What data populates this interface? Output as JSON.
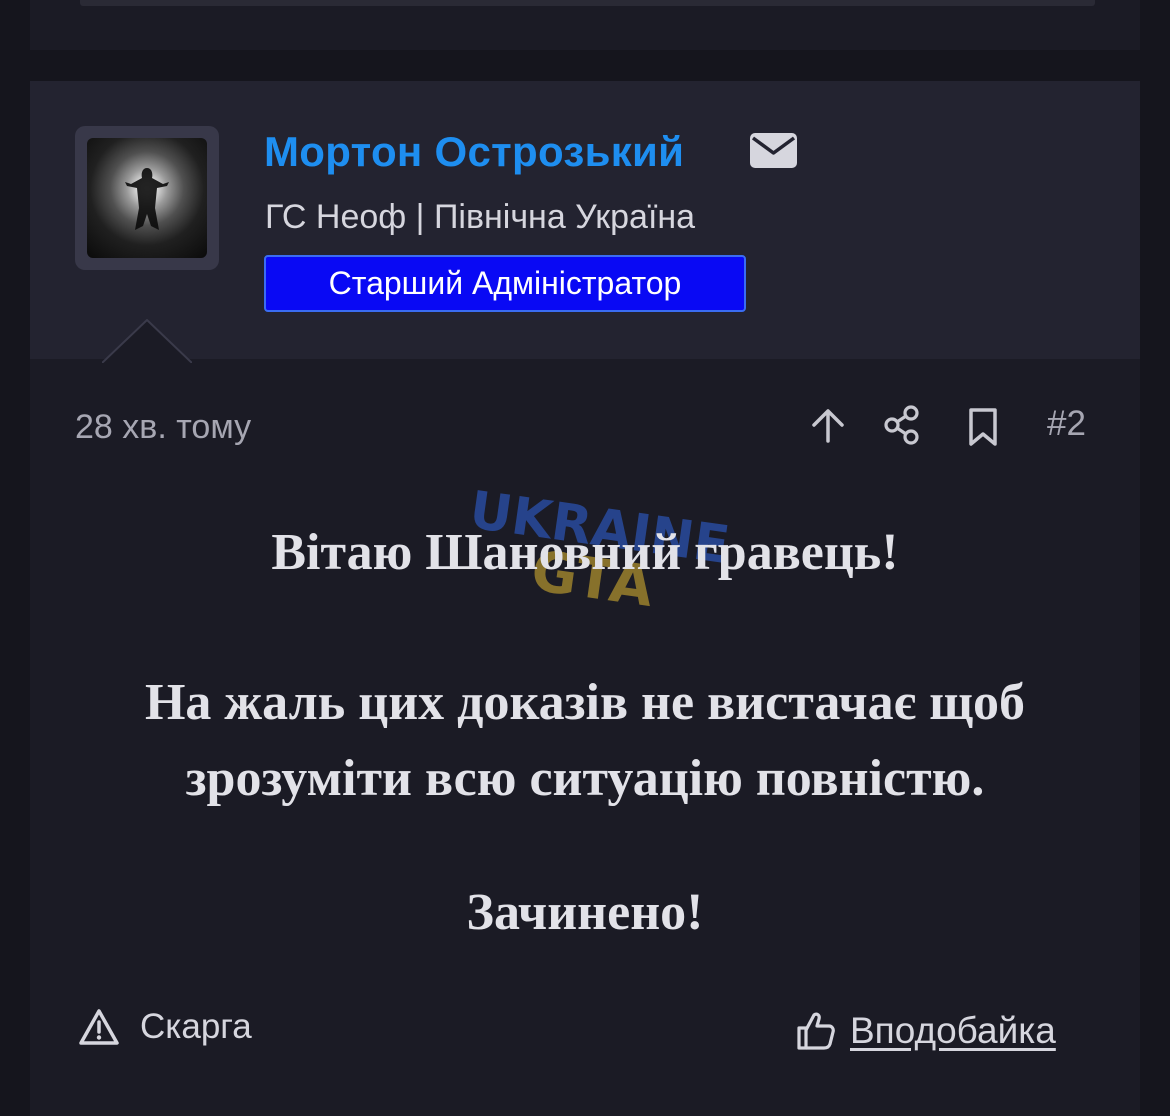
{
  "user": {
    "name": "Мортон Острозький",
    "title": "ГС Неоф | Північна Україна",
    "role": "Старший Адміністратор"
  },
  "post": {
    "time": "28 хв. тому",
    "number": "#2",
    "greeting": "Вітаю Шановний гравець!",
    "message_line1": "На жаль цих доказів не вистачає щоб",
    "message_line2": "зрозуміти всю ситуацію повністю.",
    "closing": "Зачинено!"
  },
  "actions": {
    "report_label": "Скарга",
    "like_label": "Вподобайка"
  },
  "watermark": {
    "text_top": "UKRAINE",
    "text_bottom": "GTA"
  },
  "icons": {
    "mail": "envelope-icon",
    "upvote": "arrow-up-icon",
    "share": "share-icon",
    "bookmark": "bookmark-icon",
    "report": "warning-triangle-icon",
    "like": "thumbs-up-icon"
  },
  "colors": {
    "username": "#1e8ef0",
    "role_badge": "#0909f4",
    "background": "#1b1b25",
    "header_background": "#232330"
  }
}
